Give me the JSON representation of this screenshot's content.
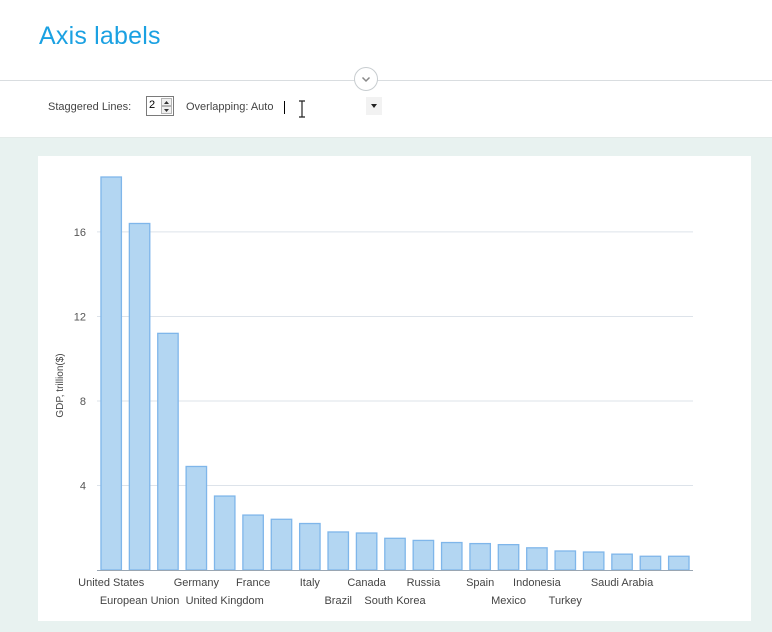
{
  "page": {
    "title": "Axis labels"
  },
  "options": {
    "staggered_label": "Staggered Lines:",
    "staggered_value": "2",
    "overlapping_value": "Overlapping: Auto"
  },
  "icons": {
    "collapse": "chevron-down-icon",
    "spin_up": "triangle-up-icon",
    "spin_down": "triangle-down-icon",
    "select_arrow": "triangle-down-icon",
    "cursor": "text-cursor-icon"
  },
  "colors": {
    "title": "#1ba1e2",
    "bar_fill": "#b3d6f2",
    "bar_stroke": "#7fb6ea",
    "background": "#e8f2f0"
  },
  "chart_data": {
    "type": "bar",
    "ylabel": "GDP, trillion($)",
    "ylim": [
      0,
      18.6
    ],
    "yticks": [
      4,
      8,
      12,
      16
    ],
    "grid": true,
    "categories": [
      "United States",
      "European Union",
      "",
      "Germany",
      "United Kingdom",
      "France",
      "",
      "Italy",
      "Brazil",
      "Canada",
      "South Korea",
      "Russia",
      "",
      "Spain",
      "Mexico",
      "Indonesia",
      "Turkey",
      "",
      "Saudi Arabia"
    ],
    "values": [
      18.6,
      16.4,
      11.2,
      4.9,
      3.5,
      2.6,
      2.4,
      2.2,
      1.8,
      1.75,
      1.5,
      1.4,
      1.3,
      1.25,
      1.2,
      1.05,
      0.9,
      0.85,
      0.75,
      0.65,
      0.65
    ],
    "label_rows": [
      0,
      1,
      0,
      0,
      1,
      0,
      0,
      0,
      1,
      0,
      1,
      0,
      0,
      0,
      1,
      0,
      1,
      0,
      0
    ]
  }
}
